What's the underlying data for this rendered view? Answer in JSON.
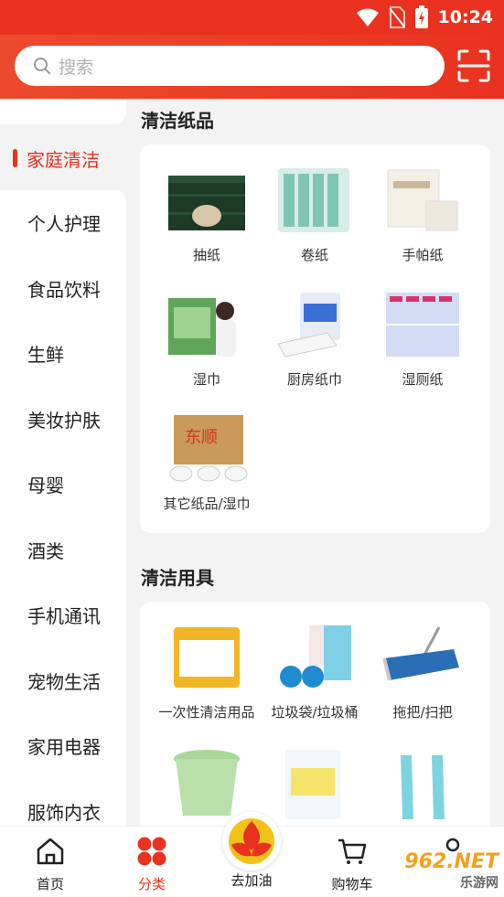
{
  "status_bar": {
    "time": "10:24"
  },
  "search": {
    "placeholder": "搜索"
  },
  "sidebar": {
    "active": "家庭清洁",
    "items": [
      "个人护理",
      "食品饮料",
      "生鲜",
      "美妆护肤",
      "母婴",
      "酒类",
      "手机通讯",
      "宠物生活",
      "家用电器",
      "服饰内衣"
    ]
  },
  "sections": [
    {
      "title": "清洁纸品",
      "products": [
        "抽纸",
        "卷纸",
        "手帕纸",
        "湿巾",
        "厨房纸巾",
        "湿厕纸",
        "其它纸品/湿巾"
      ]
    },
    {
      "title": "清洁用具",
      "products": [
        "一次性清洁用品",
        "垃圾袋/垃圾桶",
        "拖把/扫把"
      ]
    }
  ],
  "tabbar": {
    "items": [
      "首页",
      "分类",
      "去加油",
      "购物车"
    ]
  },
  "watermark": {
    "brand": "962.NET",
    "sub": "乐游网"
  },
  "colors": {
    "accent": "#e8321f",
    "background": "#f3f3f3"
  }
}
